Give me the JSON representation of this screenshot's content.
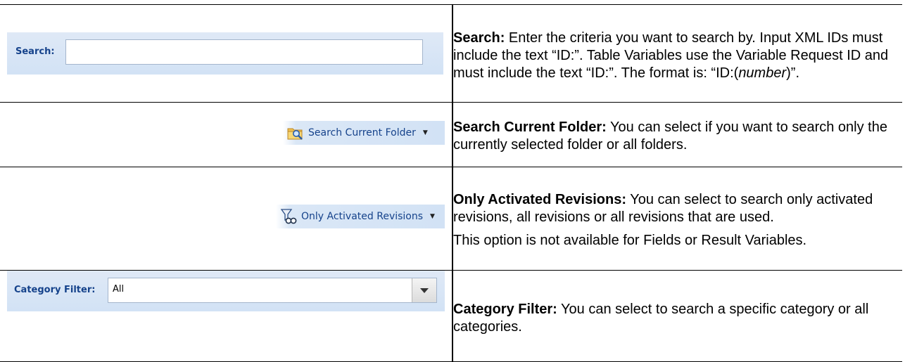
{
  "rows": [
    {
      "ui": {
        "label": "Search:",
        "input_value": ""
      },
      "term": "Search:",
      "paragraphs": [
        {
          "text_before": " Enter the criteria you want to search by. Input XML IDs must include the text “ID:”. Table Variables use the Variable Request ID and must include the text “ID:”. The format is: “ID:(",
          "italic": "number",
          "text_after": ")”."
        }
      ]
    },
    {
      "ui": {
        "button_label": "Search Current Folder",
        "icon": "folder-search-icon"
      },
      "term": "Search Current Folder:",
      "paragraphs": [
        {
          "text": " You can select if you want to search only the currently selected folder or all folders."
        }
      ]
    },
    {
      "ui": {
        "button_label": "Only Activated Revisions",
        "icon": "filter-binoculars-icon"
      },
      "term": "Only Activated Revisions:",
      "paragraphs": [
        {
          "text": " You can select to search only activated revisions, all revisions or all revisions that are used."
        },
        {
          "text": "This option is not available for Fields or Result Variables."
        }
      ]
    },
    {
      "ui": {
        "label": "Category Filter:",
        "selected": "All"
      },
      "term": "Category Filter:",
      "paragraphs": [
        {
          "text": " You can select to search a specific category or all categories."
        }
      ]
    }
  ]
}
